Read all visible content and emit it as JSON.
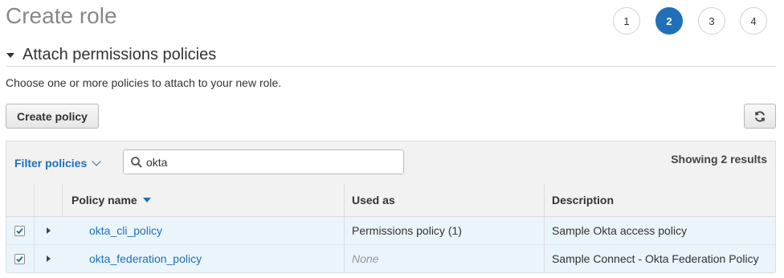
{
  "page": {
    "title": "Create role"
  },
  "steps": [
    "1",
    "2",
    "3",
    "4"
  ],
  "active_step": "2",
  "section": {
    "title": "Attach permissions policies",
    "description": "Choose one or more policies to attach to your new role."
  },
  "toolbar": {
    "create_policy_label": "Create policy",
    "refresh_icon": "refresh-icon"
  },
  "filter": {
    "label": "Filter policies",
    "search_value": "okta",
    "results_text": "Showing 2 results"
  },
  "table": {
    "columns": [
      "Policy name",
      "Used as",
      "Description"
    ],
    "sort_column": "Policy name",
    "rows": [
      {
        "checked": true,
        "policy_name": "okta_cli_policy",
        "used_as": "Permissions policy (1)",
        "description": "Sample Okta access policy"
      },
      {
        "checked": true,
        "policy_name": "okta_federation_policy",
        "used_as": "None",
        "description": "Sample Connect - Okta Federation Policy"
      }
    ]
  },
  "colors": {
    "accent": "#1f70b8",
    "row_selected_bg": "#eaf4fb"
  }
}
